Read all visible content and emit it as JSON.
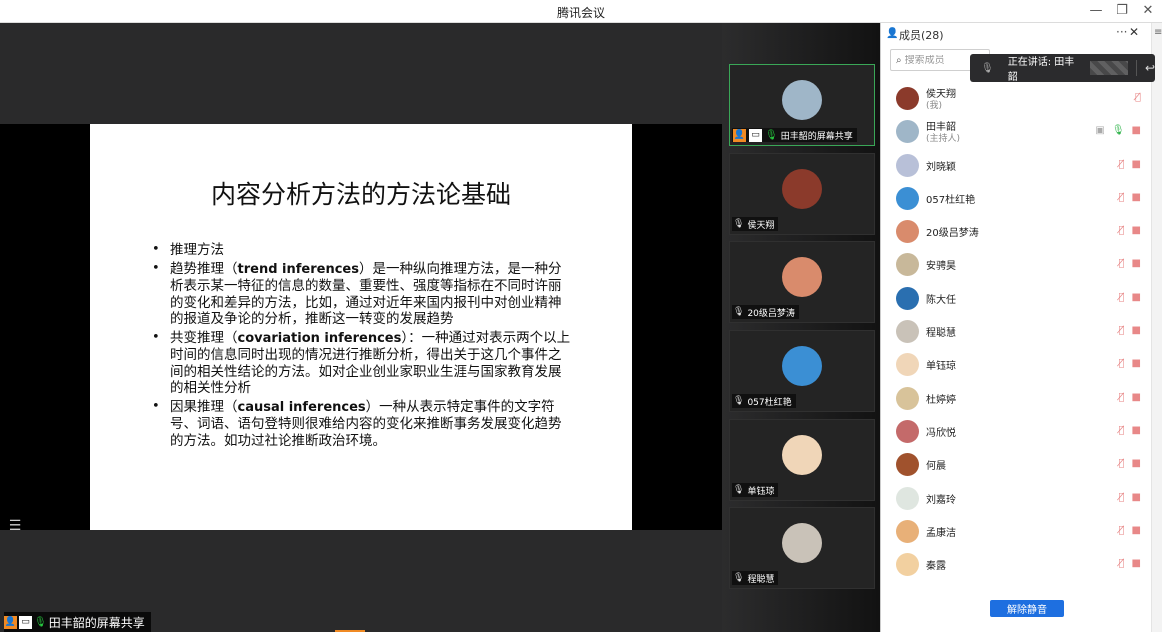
{
  "window": {
    "title": "腾讯会议",
    "controls": [
      "—",
      "❐",
      "✕"
    ]
  },
  "slide": {
    "title": "内容分析方法的方法论基础",
    "bullets": [
      {
        "lead": "推理方法",
        "term": "",
        "rest": ""
      },
      {
        "lead": "趋势推理（",
        "term": "trend inferences",
        "rest": "）是一种纵向推理方法，是一种分析表示某一特征的信息的数量、重要性、强度等指标在不同时许丽的变化和差异的方法，比如，通过对近年来国内报刊中对创业精神的报道及争论的分析，推断这一转变的发展趋势"
      },
      {
        "lead": "共变推理（",
        "term": "covariation inferences",
        "rest": "）：一种通过对表示两个以上时间的信息同时出现的情况进行推断分析，得出关于这几个事件之间的相关性结论的方法。如对企业创业家职业生涯与国家教育发展的相关性分析"
      },
      {
        "lead": "因果推理（",
        "term": "causal inferences",
        "rest": "）一种从表示特定事件的文字符号、词语、语句登特则很难给内容的变化来推断事务发展变化趋势的方法。如功过社论推断政治环境。"
      }
    ]
  },
  "share_tag": "田丰韶的屏幕共享",
  "videos": [
    {
      "label": "田丰韶的屏幕共享",
      "active": true,
      "color": "#9fb6c8"
    },
    {
      "label": "侯天翔",
      "active": false,
      "color": "#8b3a2b"
    },
    {
      "label": "20级吕梦涛",
      "active": false,
      "color": "#d98b6c"
    },
    {
      "label": "057杜红艳",
      "active": false,
      "color": "#3b8fd4"
    },
    {
      "label": "单钰琼",
      "active": false,
      "color": "#f0d6b8"
    },
    {
      "label": "程聪慧",
      "active": false,
      "color": "#c9c2b8"
    }
  ],
  "panel": {
    "header": "成员(28)",
    "more": "···",
    "close": "✕",
    "search_placeholder": "搜索成员",
    "speaking": "正在讲话: 田丰韶",
    "unmute": "解除静音"
  },
  "members": [
    {
      "name": "侯天翔",
      "sub": "(我)",
      "color": "#8b3a2b",
      "icons": [
        "mute"
      ]
    },
    {
      "name": "田丰韶",
      "sub": "(主持人)",
      "color": "#9fb6c8",
      "icons": [
        "share",
        "mic-on",
        "cam"
      ]
    },
    {
      "name": "刘晓颖",
      "sub": "",
      "color": "#b8c0d8",
      "icons": [
        "mute",
        "cam"
      ]
    },
    {
      "name": "057杜红艳",
      "sub": "",
      "color": "#3b8fd4",
      "icons": [
        "mute",
        "cam"
      ]
    },
    {
      "name": "20级吕梦涛",
      "sub": "",
      "color": "#d98b6c",
      "icons": [
        "mute",
        "cam"
      ]
    },
    {
      "name": "安骋昊",
      "sub": "",
      "color": "#c8b89a",
      "icons": [
        "mute",
        "cam"
      ]
    },
    {
      "name": "陈大任",
      "sub": "",
      "color": "#2a6fb0",
      "icons": [
        "mute",
        "cam"
      ]
    },
    {
      "name": "程聪慧",
      "sub": "",
      "color": "#c9c2b8",
      "icons": [
        "mute",
        "cam"
      ]
    },
    {
      "name": "单钰琼",
      "sub": "",
      "color": "#f0d6b8",
      "icons": [
        "mute",
        "cam"
      ]
    },
    {
      "name": "杜婷婷",
      "sub": "",
      "color": "#d8c39a",
      "icons": [
        "mute",
        "cam"
      ]
    },
    {
      "name": "冯欣悦",
      "sub": "",
      "color": "#c46a6a",
      "icons": [
        "mute",
        "cam"
      ]
    },
    {
      "name": "何晨",
      "sub": "",
      "color": "#a0522d",
      "icons": [
        "mute",
        "cam"
      ]
    },
    {
      "name": "刘嘉玲",
      "sub": "",
      "color": "#dfe6e0",
      "icons": [
        "mute",
        "cam"
      ]
    },
    {
      "name": "孟康洁",
      "sub": "",
      "color": "#e8b078",
      "icons": [
        "mute",
        "cam"
      ]
    },
    {
      "name": "秦露",
      "sub": "",
      "color": "#f2d0a0",
      "icons": [
        "mute",
        "cam"
      ]
    }
  ],
  "colors": {
    "accent": "#1e6fe0",
    "active_border": "#3aa757",
    "share_icon": "#f08a24"
  }
}
